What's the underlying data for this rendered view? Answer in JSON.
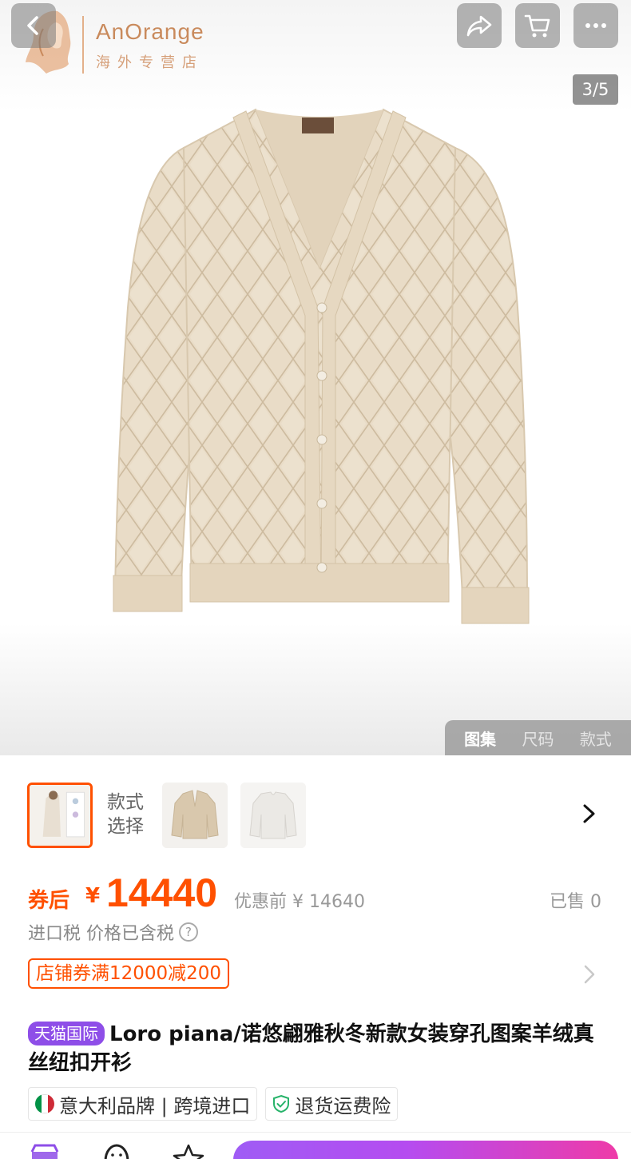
{
  "header": {
    "store_name": "AnOrange",
    "store_subtitle": "海外专营店",
    "page_counter": "3/5"
  },
  "gallery_tabs": [
    {
      "label": "图集",
      "active": true
    },
    {
      "label": "尺码",
      "active": false
    },
    {
      "label": "款式",
      "active": false
    }
  ],
  "variants": {
    "label": "款式选择",
    "count": 3,
    "selected_index": 0
  },
  "price": {
    "coupon_prefix": "券后",
    "currency": "¥",
    "amount": "14440",
    "original": "优惠前 ¥ 14640",
    "sold": "已售 0"
  },
  "tax": {
    "text": "进口税 价格已含税",
    "help_icon": "?"
  },
  "coupon": {
    "text": "店铺券满12000减200"
  },
  "product": {
    "tag": "天猫国际",
    "title": "Loro piana/诺悠翩雅秋冬新款女装穿孔图案羊绒真丝纽扣开衫"
  },
  "services": [
    {
      "icon": "italy-flag-icon",
      "text": "意大利品牌 | 跨境进口"
    },
    {
      "icon": "shield-check-icon",
      "text": "退货运费险"
    }
  ],
  "colors": {
    "accent": "#ff5000",
    "tmall_purple": "#8e4ee8",
    "store_brand": "#c98a5c"
  }
}
